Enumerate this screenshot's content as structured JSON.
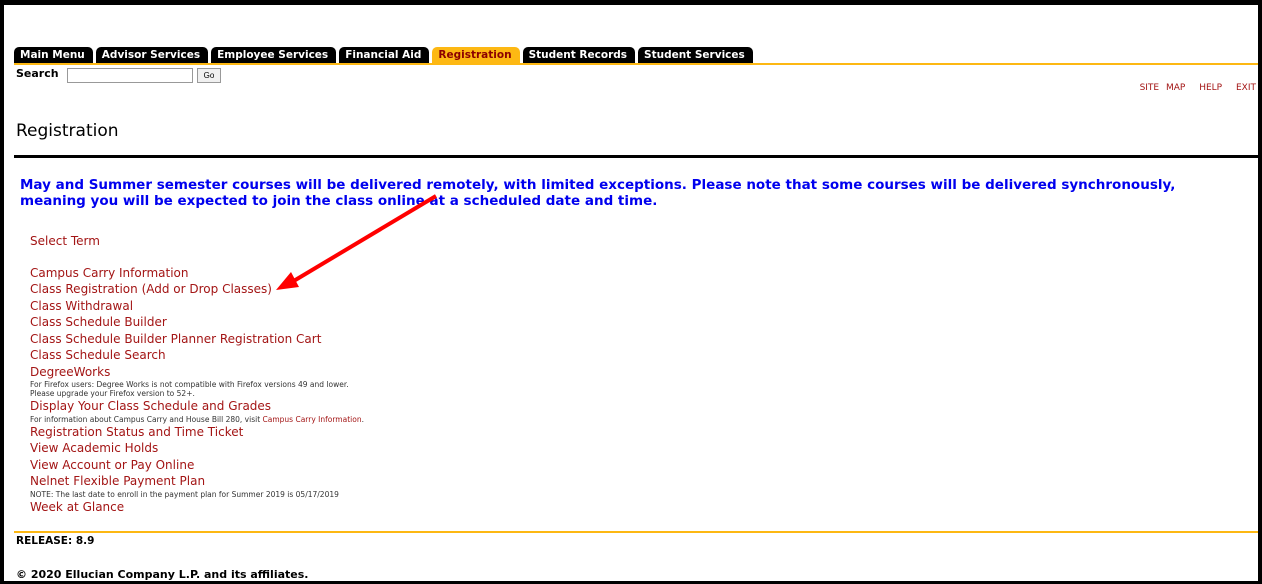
{
  "tabs": [
    {
      "label": "Main Menu",
      "active": false
    },
    {
      "label": "Advisor Services",
      "active": false
    },
    {
      "label": "Employee Services",
      "active": false
    },
    {
      "label": "Financial Aid",
      "active": false
    },
    {
      "label": "Registration",
      "active": true
    },
    {
      "label": "Student Records",
      "active": false
    },
    {
      "label": "Student Services",
      "active": false
    }
  ],
  "search": {
    "label": "Search",
    "value": "",
    "go_label": "Go"
  },
  "top_links": {
    "site_map": "SITE MAP",
    "help": "HELP",
    "exit": "EXIT"
  },
  "page_title": "Registration",
  "notice": "May and Summer semester courses will be delivered remotely, with limited exceptions. Please note that some courses will be delivered synchronously, meaning you will be expected to join the class online at a scheduled date and time.",
  "menu": {
    "select_term": "Select Term",
    "campus_carry": "Campus Carry Information",
    "class_registration": "Class Registration (Add or Drop Classes)",
    "class_withdrawal": "Class Withdrawal",
    "schedule_builder": "Class Schedule Builder",
    "schedule_builder_cart": "Class Schedule Builder Planner Registration Cart",
    "schedule_search": "Class Schedule Search",
    "degreeworks": "DegreeWorks",
    "degreeworks_note1": "For Firefox users: Degree Works is not compatible with Firefox versions 49 and lower.",
    "degreeworks_note2": "Please upgrade your Firefox version to 52+.",
    "display_schedule": "Display Your Class Schedule and Grades",
    "display_schedule_note_prefix": "For information about Campus Carry and House Bill 280, visit",
    "display_schedule_note_link": "Campus Carry Information",
    "display_schedule_note_suffix": ".",
    "registration_status": "Registration Status and Time Ticket",
    "academic_holds": "View Academic Holds",
    "pay_online": "View Account or Pay Online",
    "nelnet": "Nelnet Flexible Payment Plan",
    "nelnet_note": "NOTE: The last date to enroll in the payment plan for Summer 2019 is 05/17/2019",
    "week_at_glance": "Week at Glance"
  },
  "release": "RELEASE: 8.9",
  "copyright": "© 2020 Ellucian Company L.P. and its affiliates.",
  "colors": {
    "accent_gold": "#fdb813",
    "link_red": "#a31515",
    "notice_blue": "#0000ee",
    "arrow_red": "#ff0000"
  }
}
